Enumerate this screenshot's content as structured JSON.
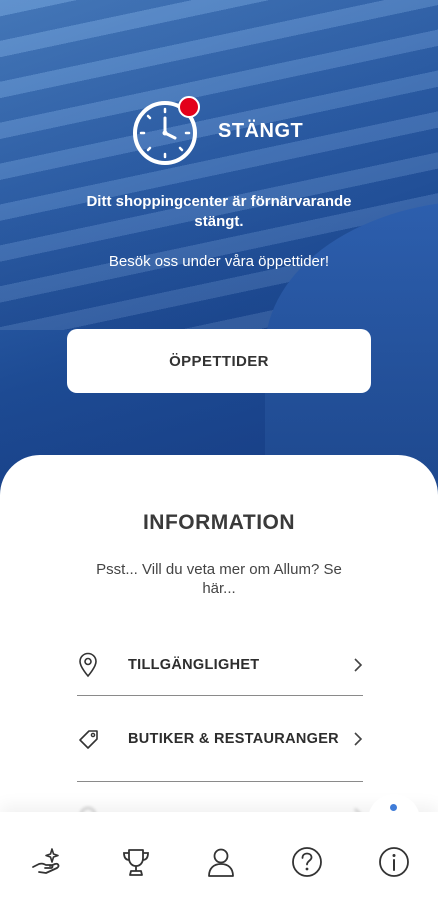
{
  "status": {
    "label": "STÄNGT",
    "message": "Ditt shoppingcenter är förnärvarande stängt.",
    "visit": "Besök oss under våra öppettider!",
    "hours_button": "ÖPPETTIDER",
    "icon": "clock-icon",
    "indicator_color": "#e3001b"
  },
  "info": {
    "title": "INFORMATION",
    "subtitle": "Psst... Vill du veta mer om Allum? Se här...",
    "items": [
      {
        "label": "TILLGÄNGLIGHET",
        "icon": "location-pin-icon"
      },
      {
        "label": "BUTIKER & RESTAURANGER",
        "icon": "tag-icon"
      },
      {
        "label": "",
        "icon": "faded-item-icon"
      }
    ]
  },
  "tabbar": {
    "items": [
      {
        "icon": "offers-hand-icon"
      },
      {
        "icon": "trophy-icon"
      },
      {
        "icon": "profile-icon"
      },
      {
        "icon": "help-icon"
      },
      {
        "icon": "info-icon",
        "active": true
      }
    ],
    "accent": "#3f7cd8"
  }
}
